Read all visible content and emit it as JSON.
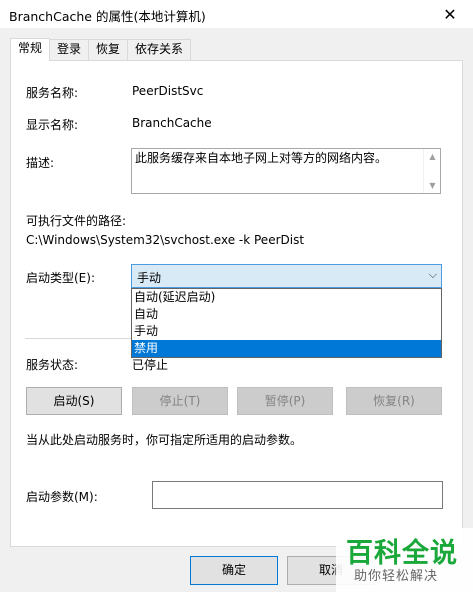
{
  "window": {
    "title": "BranchCache 的属性(本地计算机)",
    "close": "✕"
  },
  "tabs": [
    {
      "label": "常规",
      "active": true
    },
    {
      "label": "登录",
      "active": false
    },
    {
      "label": "恢复",
      "active": false
    },
    {
      "label": "依存关系",
      "active": false
    }
  ],
  "general": {
    "service_name_label": "服务名称:",
    "service_name_value": "PeerDistSvc",
    "display_name_label": "显示名称:",
    "display_name_value": "BranchCache",
    "description_label": "描述:",
    "description_value": "此服务缓存来自本地子网上对等方的网络内容。",
    "path_label": "可执行文件的路径:",
    "path_value": "C:\\Windows\\System32\\svchost.exe -k PeerDist",
    "startup_type_label": "启动类型(E):",
    "startup_type_value": "手动",
    "startup_options": [
      "自动(延迟启动)",
      "自动",
      "手动",
      "禁用"
    ],
    "highlighted_option": "禁用",
    "status_label": "服务状态:",
    "status_value": "已停止",
    "start_hint": "当从此处启动服务时，你可指定所适用的启动参数。",
    "param_label": "启动参数(M):",
    "param_value": ""
  },
  "buttons": {
    "start": "启动(S)",
    "stop": "停止(T)",
    "pause": "暂停(P)",
    "resume": "恢复(R)",
    "ok": "确定",
    "cancel": "取消"
  },
  "watermark": {
    "main": "百科全说",
    "sub": "助你轻松解决"
  },
  "colors": {
    "accent": "#0078d7",
    "combo_bg": "#d9eaf7",
    "watermark_green": "#1aa83a"
  }
}
